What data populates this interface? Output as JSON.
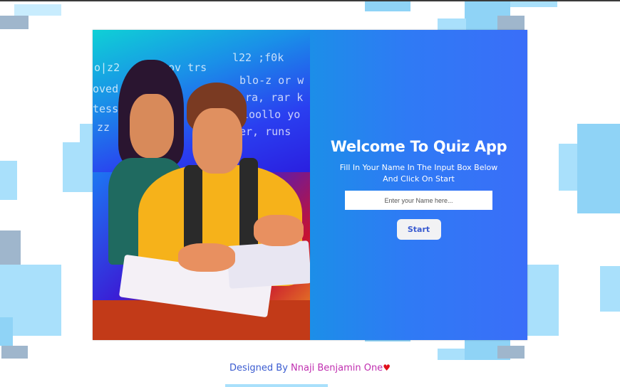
{
  "welcome": {
    "title": "Welcome To Quiz App",
    "subtitle": "Fill In Your Name In The Input Box Below And Click On Start",
    "name_placeholder": "Enter your Name here...",
    "start_label": "Start"
  },
  "hero": {
    "scribbles": [
      "o|z2",
      "ov trs",
      "l22 ;f0k",
      "oved",
      "tess",
      "zz",
      "blo-z or w",
      "ra, rar k",
      "loollo yo",
      "er, runs"
    ]
  },
  "footer": {
    "prefix": "Designed By ",
    "author": "Nnaji Benjamin One",
    "heart": "♥"
  },
  "colors": {
    "panel_accent": "#2f7af5",
    "decor_squares": "#a9e0fb",
    "author_color": "#c02fb0",
    "heart_color": "#e0101a"
  }
}
